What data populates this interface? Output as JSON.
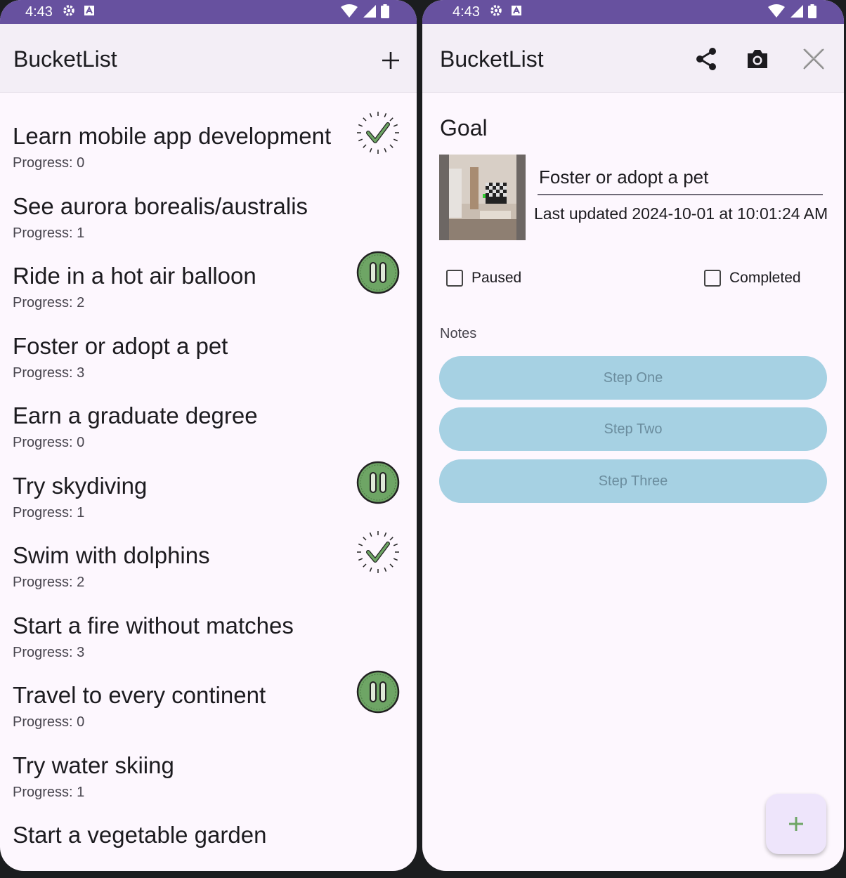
{
  "status_bar": {
    "time": "4:43"
  },
  "list_screen": {
    "app_title": "BucketList",
    "items": [
      {
        "title": "Learn mobile app development",
        "progress": "Progress: 0",
        "badge": "completed"
      },
      {
        "title": "See aurora borealis/australis",
        "progress": "Progress: 1",
        "badge": "none"
      },
      {
        "title": "Ride in a hot air balloon",
        "progress": "Progress: 2",
        "badge": "paused"
      },
      {
        "title": "Foster or adopt a pet",
        "progress": "Progress: 3",
        "badge": "none"
      },
      {
        "title": "Earn a graduate degree",
        "progress": "Progress: 0",
        "badge": "none"
      },
      {
        "title": "Try skydiving",
        "progress": "Progress: 1",
        "badge": "paused"
      },
      {
        "title": "Swim with dolphins",
        "progress": "Progress: 2",
        "badge": "completed"
      },
      {
        "title": "Start a fire without matches",
        "progress": "Progress: 3",
        "badge": "none"
      },
      {
        "title": "Travel to every continent",
        "progress": "Progress: 0",
        "badge": "paused"
      },
      {
        "title": "Try water skiing",
        "progress": "Progress: 1",
        "badge": "none"
      },
      {
        "title": "Start a vegetable garden",
        "progress": "",
        "badge": "none"
      }
    ]
  },
  "detail_screen": {
    "app_title": "BucketList",
    "goal_label": "Goal",
    "goal_title_value": "Foster or adopt a pet",
    "last_updated": "Last updated 2024-10-01 at 10:01:24 AM",
    "paused_label": "Paused",
    "paused_checked": false,
    "completed_label": "Completed",
    "completed_checked": false,
    "notes_label": "Notes",
    "steps": [
      "Step One",
      "Step Two",
      "Step Three"
    ]
  },
  "icons": {
    "add": "plus-icon",
    "share": "share-icon",
    "camera": "camera-icon",
    "close": "close-icon",
    "completed_badge": "check-badge-icon",
    "paused_badge": "pause-badge-icon"
  },
  "colors": {
    "status_bar": "#67519f",
    "app_bar": "#f3eef6",
    "background": "#fdf7fe",
    "step_button": "#a6d1e3",
    "badge_green": "#6ea565",
    "fab": "#eee5fb"
  }
}
